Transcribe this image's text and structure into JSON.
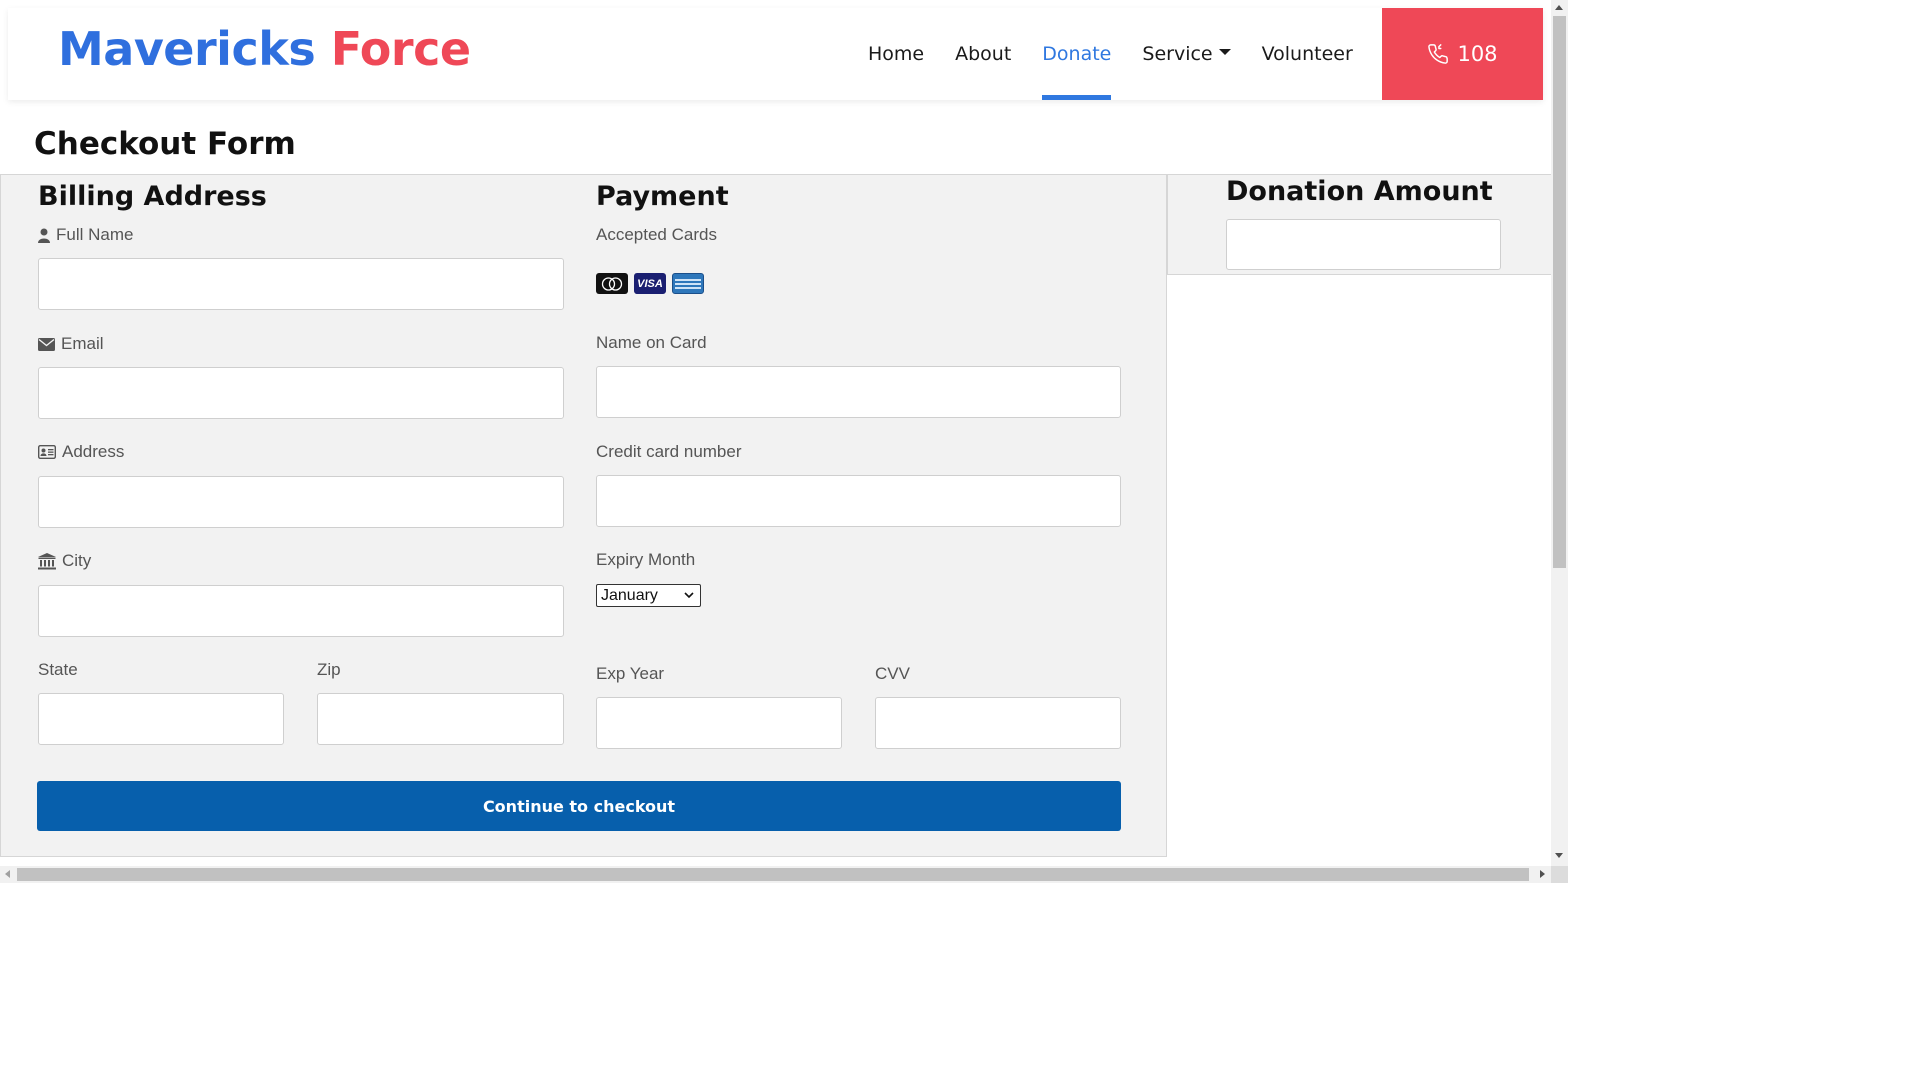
{
  "brand": {
    "part1": "Mavericks",
    "part2": "Force"
  },
  "nav": {
    "items": [
      {
        "label": "Home",
        "active": false
      },
      {
        "label": "About",
        "active": false
      },
      {
        "label": "Donate",
        "active": true
      },
      {
        "label": "Service",
        "active": false,
        "dropdown": true
      },
      {
        "label": "Volunteer",
        "active": false
      }
    ],
    "call_number": "108",
    "call_icon": "phone-icon"
  },
  "colors": {
    "brand_blue": "#2f6fde",
    "brand_red": "#ef4857",
    "button_blue": "#075fac"
  },
  "page_title": "Checkout Form",
  "billing": {
    "heading": "Billing Address",
    "full_name_label": "Full Name",
    "email_label": "Email",
    "address_label": "Address",
    "city_label": "City",
    "state_label": "State",
    "zip_label": "Zip"
  },
  "payment": {
    "heading": "Payment",
    "accepted_cards_label": "Accepted Cards",
    "cards": [
      "mastercard-icon",
      "visa-icon",
      "amex-icon"
    ],
    "visa_text": "VISA",
    "name_on_card_label": "Name on Card",
    "card_number_label": "Credit card number",
    "expiry_month_label": "Expiry Month",
    "expiry_month_value": "January",
    "exp_year_label": "Exp Year",
    "cvv_label": "CVV"
  },
  "submit_label": "Continue to checkout",
  "donation": {
    "heading": "Donation Amount"
  }
}
